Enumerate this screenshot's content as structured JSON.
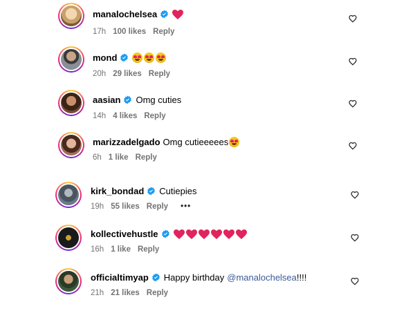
{
  "comments": [
    {
      "username": "manalochelsea",
      "text": "",
      "emojis": [
        "red-heart"
      ],
      "time": "17h",
      "likes": "100 likes",
      "reply": "Reply",
      "avatar_color": "#d8b98a"
    },
    {
      "username": "mond",
      "text": "",
      "emojis": [
        "heart-eyes-face",
        "heart-eyes-face",
        "heart-eyes-face"
      ],
      "time": "20h",
      "likes": "29 likes",
      "reply": "Reply",
      "avatar_color": "#8a8f96"
    },
    {
      "username": "aasian",
      "text": "Omg cuties",
      "emojis": [],
      "time": "14h",
      "likes": "4 likes",
      "reply": "Reply",
      "avatar_color": "#7a4a32"
    },
    {
      "username": "marizzadelgado",
      "text": "Omg cutieeeees",
      "emojis": [
        "heart-eyes-face"
      ],
      "time": "6h",
      "likes": "1 like",
      "reply": "Reply",
      "avatar_color": "#a0705a"
    },
    {
      "username": "kirk_bondad",
      "text": "Cutiepies",
      "emojis": [],
      "time": "19h",
      "likes": "55 likes",
      "reply": "Reply",
      "more": "•••",
      "avatar_color": "#6a7a86"
    },
    {
      "username": "kollectivehustle",
      "text": "",
      "emojis": [
        "red-heart",
        "red-heart",
        "red-heart",
        "red-heart",
        "red-heart",
        "red-heart"
      ],
      "time": "16h",
      "likes": "1 like",
      "reply": "Reply",
      "avatar_color": "#1a1a1a"
    },
    {
      "username": "officialtimyap",
      "text": "Happy birthday",
      "mention": "@manalochelsea",
      "text_after": "!!!!",
      "emojis": [],
      "time": "21h",
      "likes": "21 likes",
      "reply": "Reply",
      "avatar_color": "#3d5a3a"
    }
  ],
  "colors": {
    "verified_blue": "#1d9bf0",
    "heart_red": "#e0245e",
    "meta_gray": "#737373",
    "mention_blue": "#3b5998"
  },
  "icons": {
    "verified": "verified-badge-icon",
    "like": "heart-outline-icon"
  }
}
